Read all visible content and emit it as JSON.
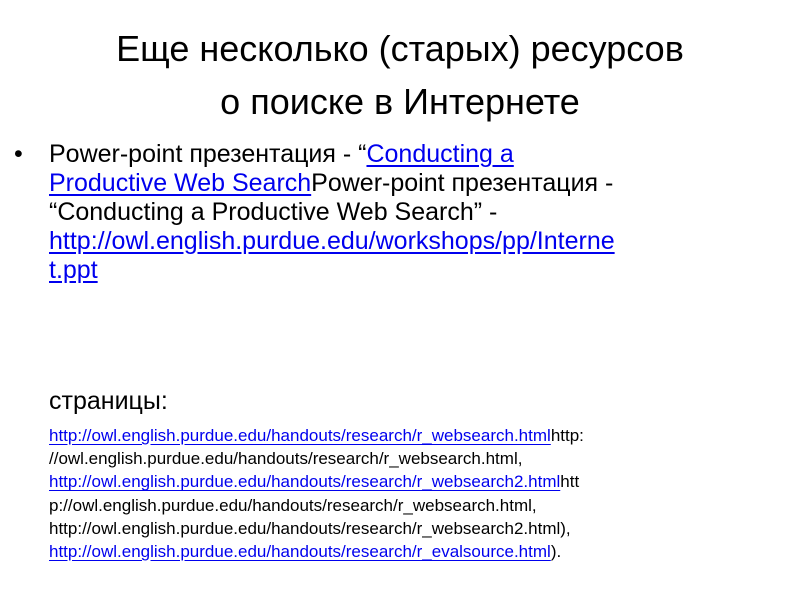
{
  "slide": {
    "title_line_1": "Еще несколько (старых) ресурсов",
    "title_line_2": "о поиске в Интернете",
    "bullet_marker": "•",
    "bullet": {
      "lines": [
        {
          "text_1": "Power-point презентация - “",
          "link": "Conducting a",
          "text_2": ""
        },
        {
          "text_1": "",
          "link": "Productive Web Search",
          "text_2": "Power-point презентация -"
        },
        {
          "text_1": "“Conducting a Productive Web Search” -",
          "link": "",
          "text_2": ""
        },
        {
          "text_1": "",
          "link": "http://owl.english.purdue.edu/workshops/pp/Interne",
          "text_2": ""
        },
        {
          "text_1": "",
          "link": "t.ppt",
          "text_2": ""
        }
      ]
    },
    "pages_label": "страницы:",
    "small": {
      "lines": [
        {
          "link": "http://owl.english.purdue.edu/handouts/research/r_websearch.html",
          "text": "http:"
        },
        {
          "link": "",
          "text": "//owl.english.purdue.edu/handouts/research/r_websearch.html,"
        },
        {
          "link": "http://owl.english.purdue.edu/handouts/research/r_websearch2.html",
          "text": "htt"
        },
        {
          "link": "",
          "text": "p://owl.english.purdue.edu/handouts/research/r_websearch.html,"
        },
        {
          "link": "",
          "text": "http://owl.english.purdue.edu/handouts/research/r_websearch2.html),"
        },
        {
          "link": "http://owl.english.purdue.edu/handouts/research/r_evalsource.html",
          "text": ")."
        }
      ]
    },
    "colors": {
      "text": "#000000",
      "link": "#0000ee",
      "background": "#ffffff"
    }
  }
}
